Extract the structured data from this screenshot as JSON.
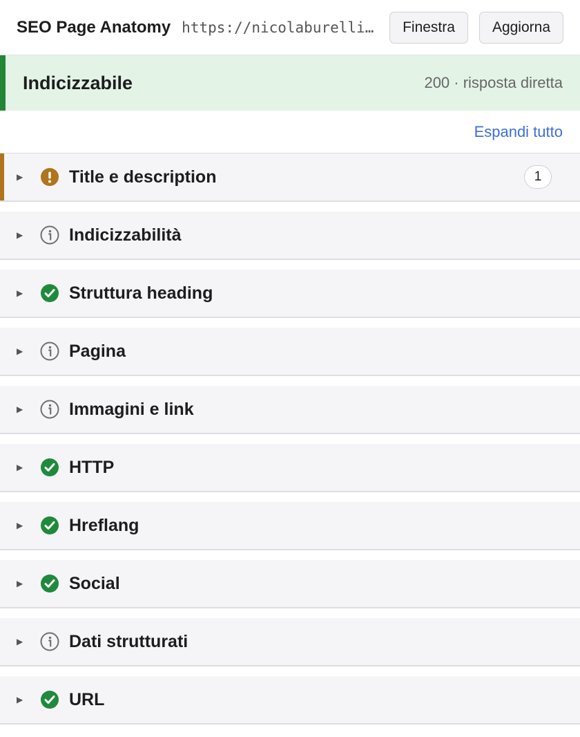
{
  "header": {
    "title": "SEO Page Anatomy",
    "url": "https://nicolaburelli.com/",
    "window_button": "Finestra",
    "refresh_button": "Aggiorna"
  },
  "status": {
    "label": "Indicizzabile",
    "meta": "200 · risposta diretta",
    "color": "#238636"
  },
  "expand_all": "Espandi tutto",
  "sections": [
    {
      "label": "Title e description",
      "status": "warning",
      "count": "1"
    },
    {
      "label": "Indicizzabilità",
      "status": "info"
    },
    {
      "label": "Struttura heading",
      "status": "ok"
    },
    {
      "label": "Pagina",
      "status": "info"
    },
    {
      "label": "Immagini e link",
      "status": "info"
    },
    {
      "label": "HTTP",
      "status": "ok"
    },
    {
      "label": "Hreflang",
      "status": "ok"
    },
    {
      "label": "Social",
      "status": "ok"
    },
    {
      "label": "Dati strutturati",
      "status": "info"
    },
    {
      "label": "URL",
      "status": "ok"
    }
  ],
  "colors": {
    "ok": "#1f8a3c",
    "warning": "#b0741c",
    "info": "#6e6e73",
    "link": "#3b6fd6"
  }
}
